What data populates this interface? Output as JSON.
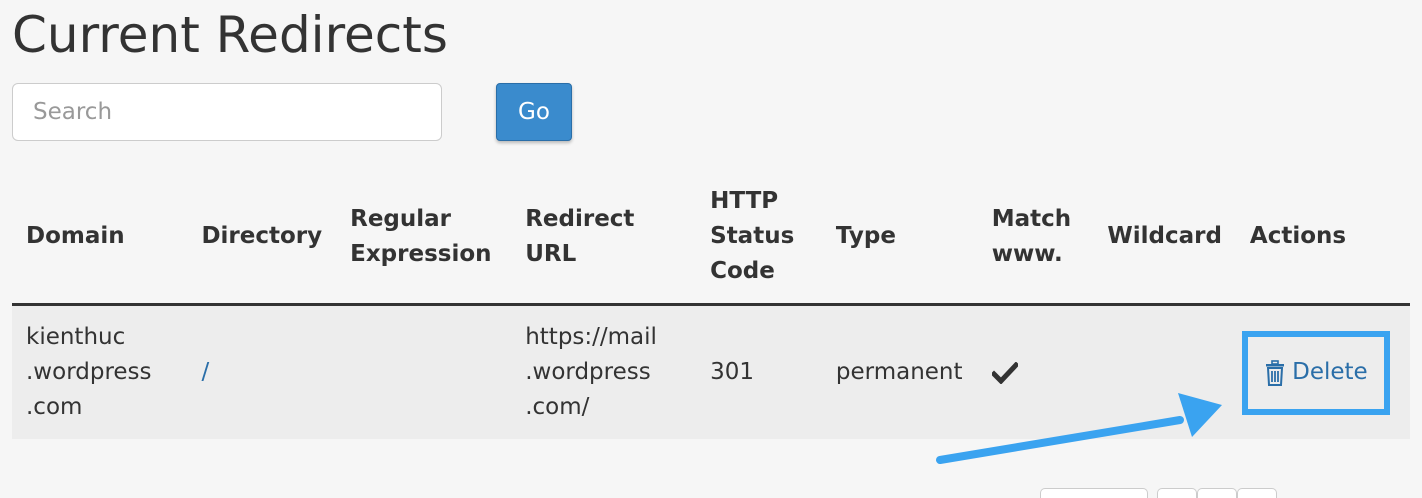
{
  "page": {
    "title": "Current Redirects"
  },
  "search": {
    "placeholder": "Search",
    "value": "",
    "go_label": "Go"
  },
  "table": {
    "columns": [
      {
        "key": "domain",
        "label": "Domain"
      },
      {
        "key": "directory",
        "label": "Directory"
      },
      {
        "key": "regex",
        "label": "Regular Expression"
      },
      {
        "key": "redirect_url",
        "label": "Redirect URL"
      },
      {
        "key": "status_code",
        "label": "HTTP Status Code"
      },
      {
        "key": "type",
        "label": "Type"
      },
      {
        "key": "match_www",
        "label": "Match www."
      },
      {
        "key": "wildcard",
        "label": "Wildcard"
      },
      {
        "key": "actions",
        "label": "Actions"
      }
    ],
    "rows": [
      {
        "domain": "kienthuc .wordpress .com",
        "directory": "/",
        "regex": "",
        "redirect_url": "https://mail .wordpress .com/",
        "status_code": "301",
        "type": "permanent",
        "match_www": true,
        "match_www_icon": "checkmark-icon",
        "wildcard": "",
        "action_label": "Delete",
        "action_icon": "trash-icon"
      }
    ]
  },
  "annotation": {
    "highlight_color": "#3aa3f0",
    "arrow_color": "#3aa3f0"
  },
  "colors": {
    "link": "#2a6ea8",
    "button_bg": "#3a8bcd",
    "row_bg": "#ededed",
    "page_bg": "#f6f6f6"
  }
}
